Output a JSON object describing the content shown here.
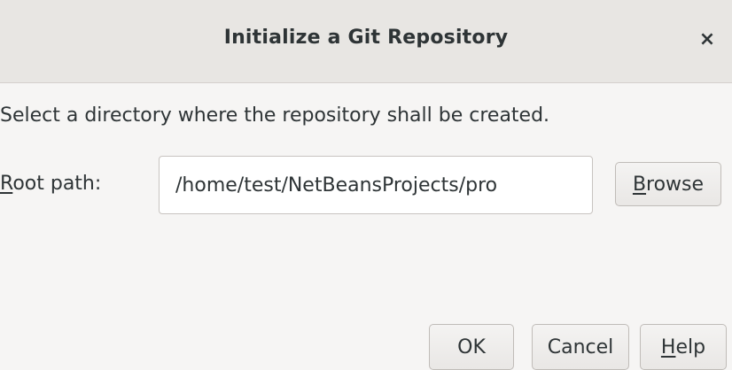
{
  "dialog": {
    "title": "Initialize a Git Repository",
    "close_symbol": "×",
    "instruction": "Select a directory where the repository shall be created.",
    "root_path": {
      "label_mnemonic": "R",
      "label_rest": "oot path:",
      "value": "/home/test/NetBeansProjects/pro"
    },
    "browse": {
      "mnemonic": "B",
      "rest": "rowse"
    },
    "ok_label": "OK",
    "cancel_label": "Cancel",
    "help": {
      "mnemonic": "H",
      "rest": "elp"
    }
  },
  "icons": {
    "close": "close-icon"
  },
  "colors": {
    "window_bg": "#f6f5f4",
    "titlebar_bg": "#e8e6e3",
    "text": "#2e3436",
    "input_bg": "#ffffff"
  }
}
